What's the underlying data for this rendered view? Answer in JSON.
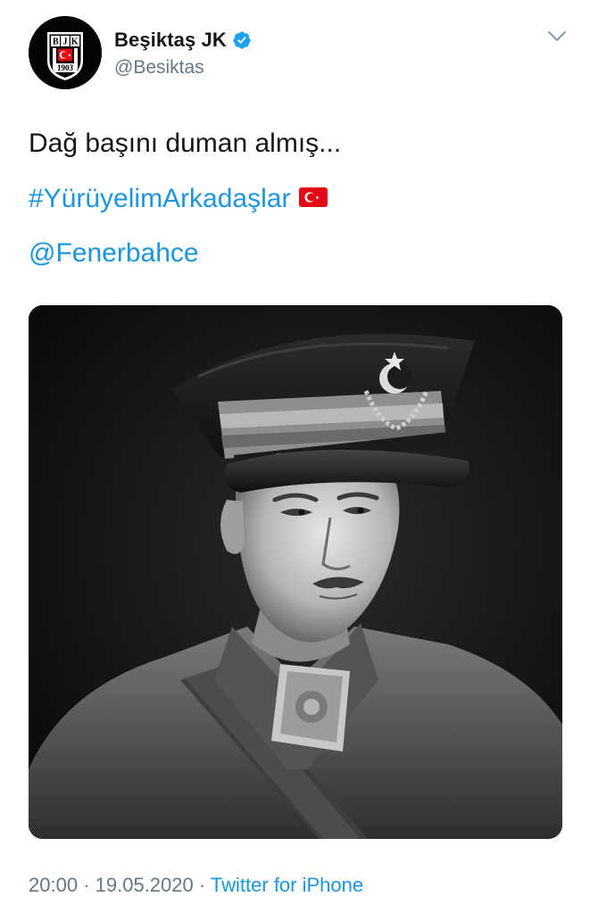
{
  "header": {
    "display_name": "Beşiktaş JK",
    "handle": "@Besiktas",
    "verified": true,
    "menu_icon": "chevron-down-icon"
  },
  "avatar": {
    "icon": "besiktas-crest-icon",
    "crest_letters": [
      "B",
      "J",
      "K"
    ],
    "crest_year": "1903"
  },
  "tweet": {
    "text": "Dağ başını duman almış...",
    "hashtag": "#YürüyelimArkadaşlar",
    "hashtag_emoji": "turkish-flag-icon",
    "mention": "@Fenerbahce"
  },
  "media": {
    "icon": "portrait-photo",
    "style": "black-and-white photograph"
  },
  "meta": {
    "time": "20:00",
    "separator": "·",
    "date": "19.05.2020",
    "source": "Twitter for iPhone"
  },
  "colors": {
    "link": "#1b95e0",
    "secondary_text": "#657786",
    "primary_text": "#14171a",
    "verified_badge": "#1da1f2",
    "flag_red": "#e30a17"
  }
}
